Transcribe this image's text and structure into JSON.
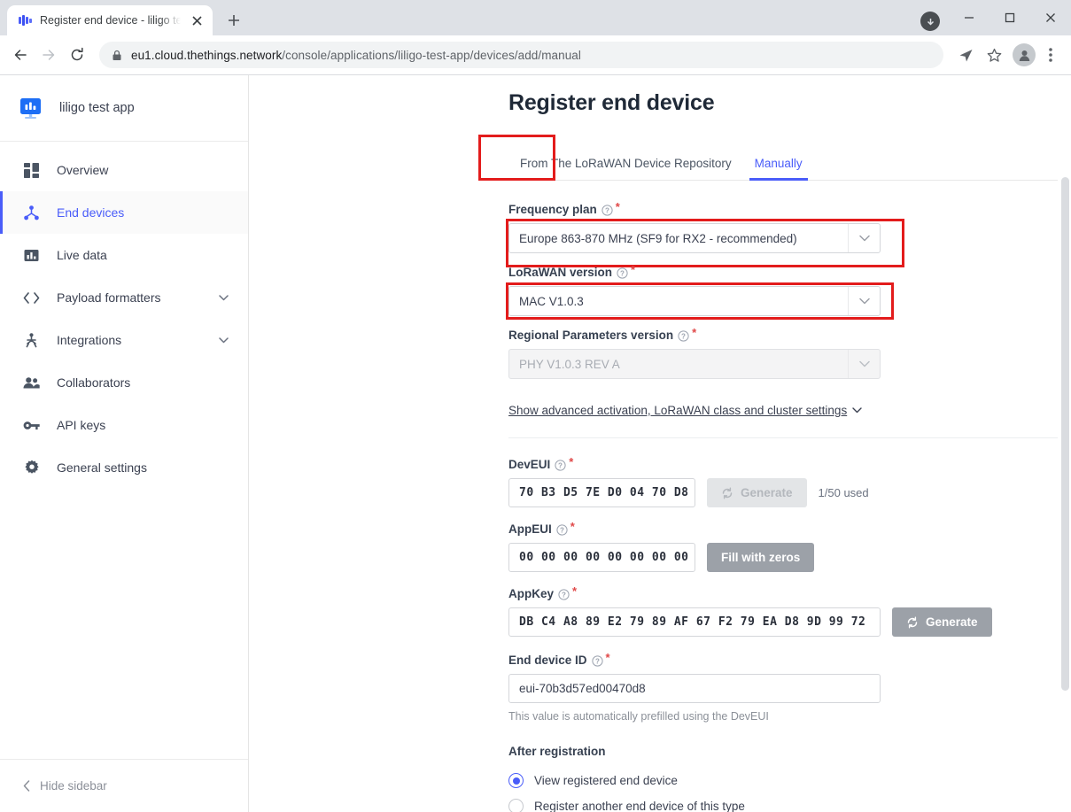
{
  "browser": {
    "tab": {
      "title": "Register end device - liligo tes",
      "favicon_icon": "ttn-logo-icon",
      "close_icon": "close-icon"
    },
    "new_tab_icon": "plus-icon",
    "window_controls": {
      "update_badge_icon": "update-arrow-icon",
      "minimize_icon": "minimize-icon",
      "maximize_icon": "maximize-icon",
      "close_icon": "window-close-icon"
    },
    "toolbar": {
      "back_icon": "arrow-left-icon",
      "forward_icon": "arrow-right-icon",
      "reload_icon": "reload-icon",
      "lock_icon": "lock-icon",
      "url_domain": "eu1.cloud.thethings.network",
      "url_path": "/console/applications/liligo-test-app/devices/add/manual",
      "share_icon": "share-icon",
      "bookmark_icon": "star-icon",
      "profile_icon": "person-icon",
      "menu_icon": "three-dots-vertical-icon"
    }
  },
  "sidebar": {
    "app_logo_icon": "app-display-icon",
    "app_name": "liligo test app",
    "items": [
      {
        "label": "Overview",
        "icon": "grid-icon",
        "active": false,
        "has_chevron": false
      },
      {
        "label": "End devices",
        "icon": "device-node-icon",
        "active": true,
        "has_chevron": false
      },
      {
        "label": "Live data",
        "icon": "bar-chart-icon",
        "active": false,
        "has_chevron": false
      },
      {
        "label": "Payload formatters",
        "icon": "code-brackets-icon",
        "active": false,
        "has_chevron": true
      },
      {
        "label": "Integrations",
        "icon": "integrations-icon",
        "active": false,
        "has_chevron": true
      },
      {
        "label": "Collaborators",
        "icon": "people-icon",
        "active": false,
        "has_chevron": false
      },
      {
        "label": "API keys",
        "icon": "key-icon",
        "active": false,
        "has_chevron": false
      },
      {
        "label": "General settings",
        "icon": "gear-icon",
        "active": false,
        "has_chevron": false
      }
    ],
    "footer": {
      "label": "Hide sidebar",
      "icon": "chevron-left-icon"
    }
  },
  "main": {
    "page_title": "Register end device",
    "tabs": [
      {
        "label": "From The LoRaWAN Device Repository",
        "active": false
      },
      {
        "label": "Manually",
        "active": true
      }
    ],
    "form": {
      "frequency_plan": {
        "label": "Frequency plan",
        "value": "Europe 863-870 MHz (SF9 for RX2 - recommended)",
        "required": "*",
        "help_icon": "question-circle-icon",
        "arrow_icon": "chevron-down-icon",
        "highlighted": true
      },
      "lorawan_version": {
        "label": "LoRaWAN version",
        "value": "MAC V1.0.3",
        "required": "*",
        "help_icon": "question-circle-icon",
        "arrow_icon": "chevron-down-icon",
        "highlighted": true
      },
      "regional_parameters": {
        "label": "Regional Parameters version",
        "value": "PHY V1.0.3 REV A",
        "required": "*",
        "help_icon": "question-circle-icon",
        "arrow_icon": "chevron-down-icon",
        "disabled": true
      },
      "advanced_link": {
        "label": "Show advanced activation, LoRaWAN class and cluster settings",
        "icon": "chevron-down-icon"
      },
      "dev_eui": {
        "label": "DevEUI",
        "value": "70 B3 D5 7E D0 04 70 D8",
        "required": "*",
        "help_icon": "question-circle-icon",
        "button_label": "Generate",
        "button_icon": "refresh-icon",
        "button_disabled": true,
        "used_text": "1/50 used"
      },
      "app_eui": {
        "label": "AppEUI",
        "value": "00 00 00 00 00 00 00 00",
        "required": "*",
        "help_icon": "question-circle-icon",
        "button_label": "Fill with zeros"
      },
      "app_key": {
        "label": "AppKey",
        "value": "DB C4 A8 89 E2 79 89 AF 67 F2 79 EA D8 9D 99 72",
        "required": "*",
        "help_icon": "question-circle-icon",
        "button_label": "Generate",
        "button_icon": "refresh-icon"
      },
      "end_device_id": {
        "label": "End device ID",
        "value": "eui-70b3d57ed00470d8",
        "required": "*",
        "help_icon": "question-circle-icon",
        "hint": "This value is automatically prefilled using the DevEUI"
      },
      "after_registration": {
        "label": "After registration",
        "options": [
          {
            "label": "View registered end device",
            "selected": true
          },
          {
            "label": "Register another end device of this type",
            "selected": false
          }
        ]
      }
    }
  },
  "colors": {
    "accent_blue": "#4a5df9",
    "annotation_red": "#e31c1c",
    "required_red": "#e04848",
    "button_grey": "#9ca1a8"
  }
}
